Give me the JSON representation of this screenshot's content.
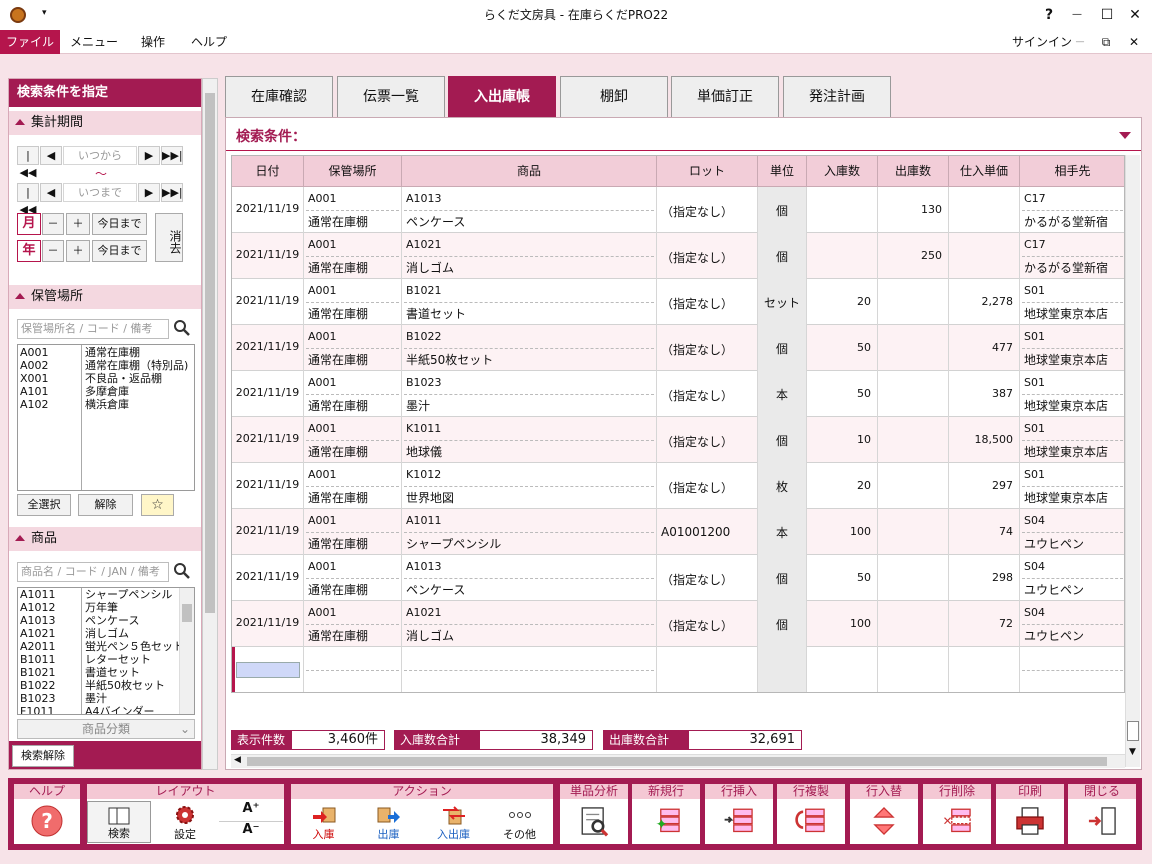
{
  "window": {
    "title": "らくだ文房具 - 在庫らくだPRO22",
    "help": "?",
    "minimize": "—",
    "maximize": "☐",
    "close": "✕",
    "qat": "▾"
  },
  "menubar": {
    "items": [
      "ファイル",
      "メニュー",
      "操作",
      "ヘルプ"
    ],
    "signin": "サインイン",
    "mdi_min": "—",
    "mdi_restore": "⧉",
    "mdi_close": "✕"
  },
  "sidebar": {
    "title": "検索条件を指定",
    "period": {
      "label": "集計期間",
      "from_placeholder": "いつから",
      "to_placeholder": "いつまで",
      "tilde": "～",
      "first": "|◀◀",
      "prev": "◀",
      "next": "▶",
      "last": "▶▶|",
      "month": "月",
      "year": "年",
      "minus": "－",
      "plus": "＋",
      "today": "今日まで",
      "clear": "消去"
    },
    "location": {
      "label": "保管場所",
      "search_placeholder": "保管場所名 / コード / 備考",
      "items": [
        {
          "code": "A001",
          "name": "通常在庫棚"
        },
        {
          "code": "A002",
          "name": "通常在庫棚（特別品)"
        },
        {
          "code": "X001",
          "name": "不良品・返品棚"
        },
        {
          "code": "A101",
          "name": "多摩倉庫"
        },
        {
          "code": "A102",
          "name": "横浜倉庫"
        }
      ],
      "select_all": "全選択",
      "deselect": "解除",
      "star": "☆"
    },
    "product": {
      "label": "商品",
      "search_placeholder": "商品名 / コード / JAN / 備考",
      "items": [
        {
          "code": "A1011",
          "name": "シャープペンシル"
        },
        {
          "code": "A1012",
          "name": "万年筆"
        },
        {
          "code": "A1013",
          "name": "ペンケース"
        },
        {
          "code": "A1021",
          "name": "消しゴム"
        },
        {
          "code": "A2011",
          "name": "蛍光ペン５色セット"
        },
        {
          "code": "B1011",
          "name": "レターセット"
        },
        {
          "code": "B1021",
          "name": "書道セット"
        },
        {
          "code": "B1022",
          "name": "半紙50枚セット"
        },
        {
          "code": "B1023",
          "name": "墨汁"
        },
        {
          "code": "F1011",
          "name": "A4バインダー"
        }
      ],
      "category": "商品分類"
    },
    "search_clear": "検索解除"
  },
  "tabs": [
    "在庫確認",
    "伝票一覧",
    "入出庫帳",
    "棚卸",
    "単価訂正",
    "発注計画"
  ],
  "active_tab": 2,
  "condition_label": "検索条件：",
  "table": {
    "headers": [
      "日付",
      "保管場所",
      "商品",
      "ロット",
      "単位",
      "入庫数",
      "出庫数",
      "仕入単価",
      "相手先"
    ],
    "rows": [
      {
        "date": "2021/11/19",
        "loc_code": "A001",
        "loc_name": "通常在庫棚",
        "prod_code": "A1013",
        "prod_name": "ペンケース",
        "lot": "（指定なし）",
        "unit": "個",
        "in": "",
        "out": "130",
        "price": "",
        "partner_code": "C17",
        "partner_name": "かるがる堂新宿"
      },
      {
        "date": "2021/11/19",
        "loc_code": "A001",
        "loc_name": "通常在庫棚",
        "prod_code": "A1021",
        "prod_name": "消しゴム",
        "lot": "（指定なし）",
        "unit": "個",
        "in": "",
        "out": "250",
        "price": "",
        "partner_code": "C17",
        "partner_name": "かるがる堂新宿"
      },
      {
        "date": "2021/11/19",
        "loc_code": "A001",
        "loc_name": "通常在庫棚",
        "prod_code": "B1021",
        "prod_name": "書道セット",
        "lot": "（指定なし）",
        "unit": "セット",
        "in": "20",
        "out": "",
        "price": "2,278",
        "partner_code": "S01",
        "partner_name": "地球堂東京本店"
      },
      {
        "date": "2021/11/19",
        "loc_code": "A001",
        "loc_name": "通常在庫棚",
        "prod_code": "B1022",
        "prod_name": "半紙50枚セット",
        "lot": "（指定なし）",
        "unit": "個",
        "in": "50",
        "out": "",
        "price": "477",
        "partner_code": "S01",
        "partner_name": "地球堂東京本店"
      },
      {
        "date": "2021/11/19",
        "loc_code": "A001",
        "loc_name": "通常在庫棚",
        "prod_code": "B1023",
        "prod_name": "墨汁",
        "lot": "（指定なし）",
        "unit": "本",
        "in": "50",
        "out": "",
        "price": "387",
        "partner_code": "S01",
        "partner_name": "地球堂東京本店"
      },
      {
        "date": "2021/11/19",
        "loc_code": "A001",
        "loc_name": "通常在庫棚",
        "prod_code": "K1011",
        "prod_name": "地球儀",
        "lot": "（指定なし）",
        "unit": "個",
        "in": "10",
        "out": "",
        "price": "18,500",
        "partner_code": "S01",
        "partner_name": "地球堂東京本店"
      },
      {
        "date": "2021/11/19",
        "loc_code": "A001",
        "loc_name": "通常在庫棚",
        "prod_code": "K1012",
        "prod_name": "世界地図",
        "lot": "（指定なし）",
        "unit": "枚",
        "in": "20",
        "out": "",
        "price": "297",
        "partner_code": "S01",
        "partner_name": "地球堂東京本店"
      },
      {
        "date": "2021/11/19",
        "loc_code": "A001",
        "loc_name": "通常在庫棚",
        "prod_code": "A1011",
        "prod_name": "シャープペンシル",
        "lot": "A01001200",
        "unit": "本",
        "in": "100",
        "out": "",
        "price": "74",
        "partner_code": "S04",
        "partner_name": "ユウヒペン"
      },
      {
        "date": "2021/11/19",
        "loc_code": "A001",
        "loc_name": "通常在庫棚",
        "prod_code": "A1013",
        "prod_name": "ペンケース",
        "lot": "（指定なし）",
        "unit": "個",
        "in": "50",
        "out": "",
        "price": "298",
        "partner_code": "S04",
        "partner_name": "ユウヒペン"
      },
      {
        "date": "2021/11/19",
        "loc_code": "A001",
        "loc_name": "通常在庫棚",
        "prod_code": "A1021",
        "prod_name": "消しゴム",
        "lot": "（指定なし）",
        "unit": "個",
        "in": "100",
        "out": "",
        "price": "72",
        "partner_code": "S04",
        "partner_name": "ユウヒペン"
      }
    ]
  },
  "totals": {
    "count_label": "表示件数",
    "count": "3,460件",
    "in_label": "入庫数合計",
    "in": "38,349",
    "out_label": "出庫数合計",
    "out": "32,691"
  },
  "toolbar": {
    "help": {
      "group": "ヘルプ"
    },
    "layout": {
      "group": "レイアウト",
      "search": "検索",
      "settings": "設定",
      "font_up": "A⁺",
      "font_down": "A⁻"
    },
    "action": {
      "group": "アクション",
      "in": "入庫",
      "out": "出庫",
      "inout": "入出庫",
      "other": "その他"
    },
    "single": {
      "group": "単品分析"
    },
    "new": {
      "group": "新規行"
    },
    "insert": {
      "group": "行挿入"
    },
    "copy": {
      "group": "行複製"
    },
    "swap": {
      "group": "行入替"
    },
    "delete": {
      "group": "行削除"
    },
    "print": {
      "group": "印刷"
    },
    "close": {
      "group": "閉じる"
    }
  },
  "colors": {
    "accent": "#a31b52",
    "background": "#f7e3e8",
    "header": "#f2cdd8"
  }
}
